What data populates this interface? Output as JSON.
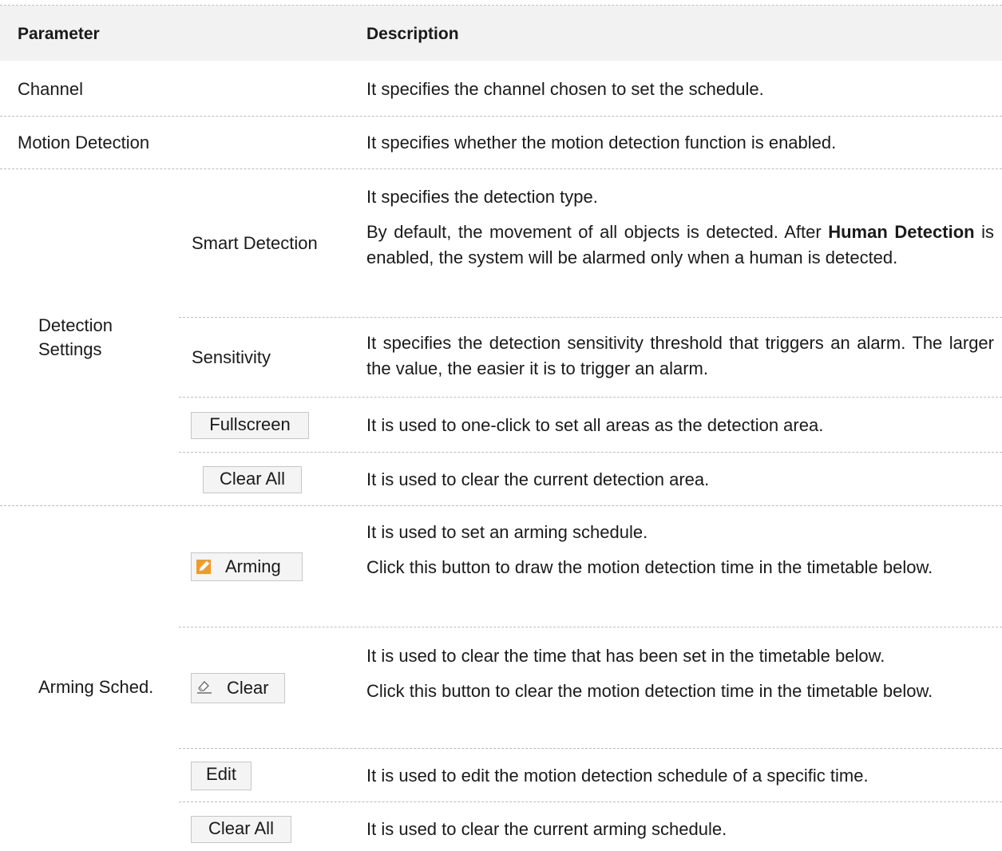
{
  "table": {
    "header": {
      "parameter": "Parameter",
      "description": "Description"
    },
    "rows": {
      "channel": {
        "param": "Channel",
        "desc": "It specifies the channel chosen to set the schedule."
      },
      "motion": {
        "param": "Motion Detection",
        "desc": "It specifies whether the motion detection function is enabled."
      },
      "detection": {
        "param": "Detection Settings",
        "smart": {
          "label": "Smart Detection",
          "desc1": "It specifies the detection type.",
          "desc2_pre": "By default, the movement of all objects is detected. After ",
          "desc2_bold": "Human Detection",
          "desc2_post": " is enabled, the system will be alarmed only when a human is detected."
        },
        "sensitivity": {
          "label": "Sensitivity",
          "desc": "It specifies the detection sensitivity threshold that triggers an alarm. The larger the value, the easier it is to trigger an alarm."
        },
        "fullscreen": {
          "button": "Fullscreen",
          "desc": "It is used to one-click to set all areas as the detection area."
        },
        "clear_all": {
          "button": "Clear All",
          "desc": "It is used to clear the current detection area."
        }
      },
      "arming": {
        "param": "Arming Sched.",
        "arming": {
          "button": "Arming",
          "icon": "pencil-icon",
          "desc1": "It is used to set an arming schedule.",
          "desc2": "Click this button to draw the motion detection time in the timetable below."
        },
        "clear": {
          "button": "Clear",
          "icon": "eraser-icon",
          "desc1": "It is used to clear the time that has been set in the timetable below.",
          "desc2": "Click this button to clear the motion detection time in the timetable below."
        },
        "edit": {
          "button": "Edit",
          "desc": "It is used to edit the motion detection schedule of a specific time."
        },
        "clear_all": {
          "button": "Clear All",
          "desc": "It is used to clear the current arming schedule."
        }
      }
    }
  }
}
